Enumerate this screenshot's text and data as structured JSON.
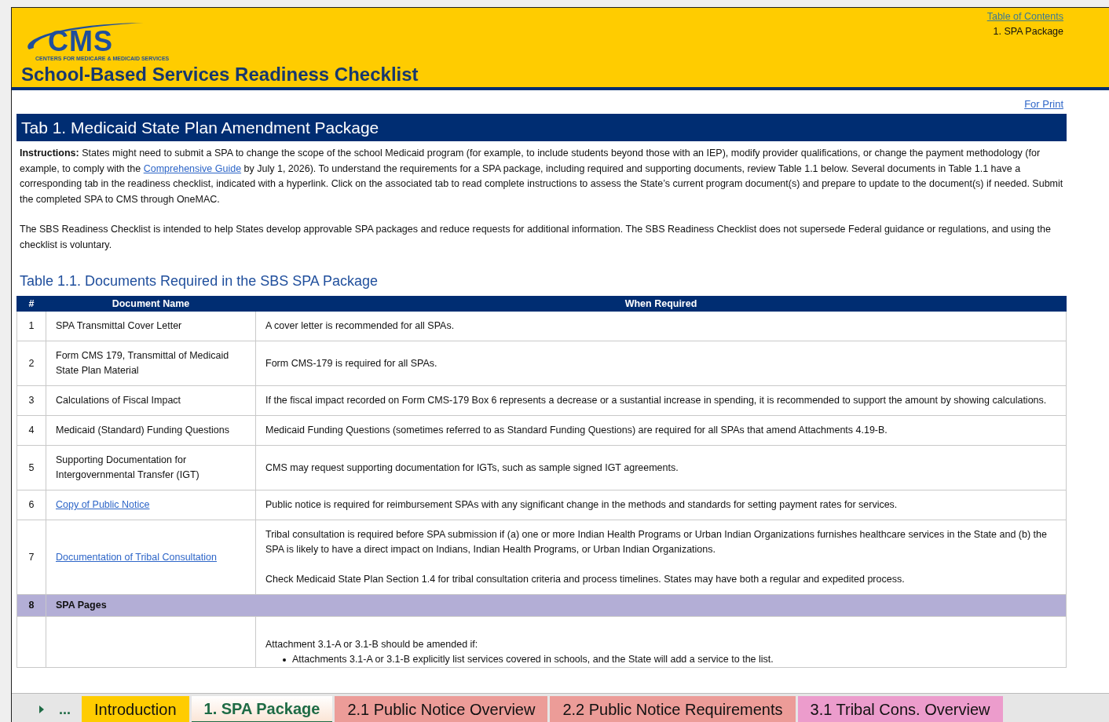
{
  "header": {
    "logo": {
      "letters": "CMS",
      "tagline": "CENTERS FOR MEDICARE & MEDICAID SERVICES"
    },
    "title": "School-Based Services Readiness Checklist",
    "toc_link": "Table of Contents",
    "current": "1. SPA Package"
  },
  "print_link": "For Print",
  "section_title": "Tab 1. Medicaid State Plan Amendment Package",
  "instructions": [
    {
      "kind": "text",
      "text": "**Instructions:** States might need to submit a SPA to change the scope of the school Medicaid program (for example, to include students beyond those with an IEP), modify provider qualifications, or change the payment methodology (for example, to comply with the "
    },
    {
      "kind": "link",
      "text": "Comprehensive Guide"
    },
    {
      "kind": "text",
      "text": " by July 1, 2026). To understand the requirements for a SPA package, including required and supporting documents, review Table 1.1 below. Several documents in Table 1.1 have a corresponding tab in the readiness checklist, indicated with a hyperlink. Click on the associated tab to read complete instructions to assess the State’s current program document(s) and prepare to update to the document(s) if needed. Submit the completed SPA to CMS through OneMAC."
    }
  ],
  "note": "The SBS Readiness Checklist is intended to help States develop approvable SPA packages and reduce requests for additional information. The SBS Readiness Checklist does not supersede Federal guidance or regulations, and using the checklist is voluntary.",
  "table": {
    "title": "Table 1.1. Documents Required in the SBS SPA Package",
    "columns": [
      "#",
      "Document Name",
      "When Required"
    ],
    "rows": [
      {
        "kind": "item",
        "num": "1",
        "name": "SPA Transmittal Cover Letter",
        "link": false,
        "when": [
          "A cover letter is recommended for all SPAs."
        ]
      },
      {
        "kind": "item",
        "num": "2",
        "name": "Form CMS 179, Transmittal of Medicaid State Plan Material",
        "link": false,
        "when": [
          "Form CMS-179 is required for all SPAs."
        ]
      },
      {
        "kind": "item",
        "num": "3",
        "name": "Calculations of Fiscal Impact",
        "link": false,
        "when": [
          "If the fiscal impact recorded on Form CMS-179 Box 6 represents a decrease or a sustantial increase in spending, it is recommended to support the amount by showing calculations."
        ]
      },
      {
        "kind": "item",
        "num": "4",
        "name": "Medicaid (Standard) Funding Questions",
        "link": false,
        "when": [
          "Medicaid Funding Questions (sometimes referred to as Standard Funding Questions) are required for all SPAs that amend Attachments 4.19-B."
        ]
      },
      {
        "kind": "item",
        "num": "5",
        "name": "Supporting Documentation for Intergovernmental Transfer (IGT)",
        "link": false,
        "when": [
          "CMS may request supporting documentation for IGTs, such as sample signed IGT agreements."
        ]
      },
      {
        "kind": "item",
        "num": "6",
        "name": "Copy of Public Notice",
        "link": true,
        "when": [
          "Public notice is required for reimbursement SPAs with any significant change in the methods and standards for setting payment rates for services."
        ]
      },
      {
        "kind": "item",
        "num": "7",
        "name": "Documentation of Tribal Consultation",
        "link": true,
        "when": [
          "Tribal consultation is required before SPA submission if (a) one or more Indian Health Programs or Urban Indian Organizations furnishes healthcare services in the State and (b) the SPA is likely to have a direct impact on Indians, Indian Health Programs, or Urban Indian Organizations.",
          "Check Medicaid State Plan Section 1.4 for tribal consultation criteria and process timelines.  States may have both a regular and expedited process."
        ]
      },
      {
        "kind": "section",
        "num": "8",
        "name": "SPA Pages"
      },
      {
        "kind": "item",
        "num": "",
        "name": "",
        "when": [
          "Attachment 3.1-A or 3.1-B should be amended if:"
        ],
        "bullets": [
          "Attachments 3.1-A or 3.1-B explicitly list services covered in schools, and the State will add a service to the list."
        ]
      }
    ]
  },
  "sheet_nav": {
    "more": "..."
  },
  "sheet_tabs": [
    {
      "label": "Introduction",
      "color": "#ffcc00",
      "selected": false
    },
    {
      "label": "1. SPA Package",
      "color": "#fbe5d6",
      "selected": true
    },
    {
      "label": "2.1 Public Notice Overview",
      "color": "#ec9c98",
      "selected": false
    },
    {
      "label": "2.2 Public Notice Requirements",
      "color": "#ec9c98",
      "selected": false
    },
    {
      "label": "3.1 Tribal Cons. Overview",
      "color": "#ec9ccc",
      "selected": false
    }
  ]
}
